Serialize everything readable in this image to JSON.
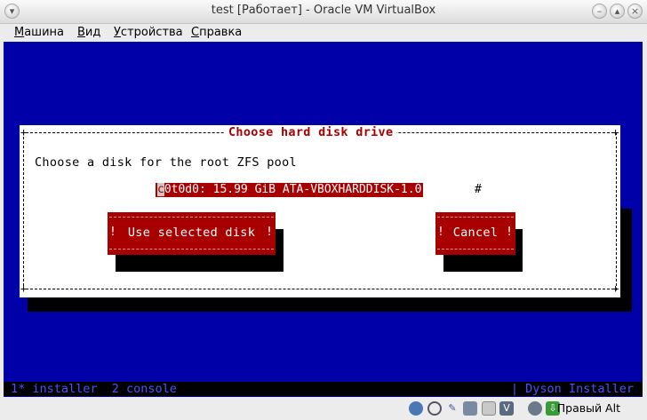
{
  "window": {
    "title": "test [Работает] - Oracle VM VirtualBox"
  },
  "menu": {
    "items": [
      {
        "first": "М",
        "rest": "ашина"
      },
      {
        "first": "В",
        "rest": "ид"
      },
      {
        "first": "У",
        "rest": "стройства"
      },
      {
        "first": "С",
        "rest": "правка"
      }
    ]
  },
  "dialog": {
    "title": "Choose hard disk drive",
    "prompt": "Choose a disk for the root ZFS pool",
    "disk_first_char": "c",
    "disk_rest": "0t0d0: 15.99 GiB ATA-VBOXHARDDISK-1.0",
    "scroll_marker": "#",
    "use_button": "Use selected disk",
    "cancel_button": "Cancel"
  },
  "statusline": {
    "left": "1* installer  2 console",
    "right": "| Dyson Installer"
  },
  "statusbar": {
    "host_key": "Правый Alt"
  },
  "colors": {
    "console_bg": "#0000a8",
    "dialog_accent": "#a80000"
  }
}
